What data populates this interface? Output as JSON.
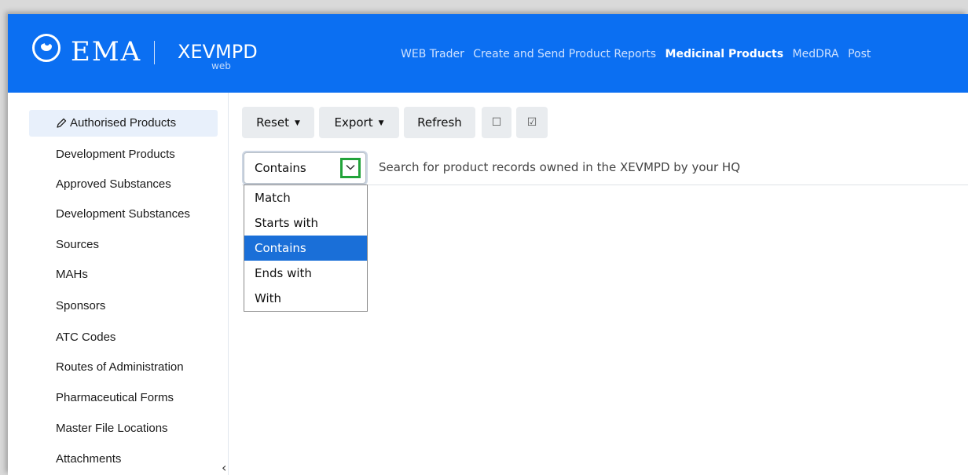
{
  "header": {
    "org_name": "EMA",
    "app_name": "XEVMPD",
    "app_sub": "web",
    "nav": [
      "WEB Trader",
      "Create and Send Product Reports",
      "Medicinal Products",
      "MedDRA",
      "Post"
    ],
    "active_nav": "Medicinal Products"
  },
  "sidebar": {
    "items": [
      "Authorised Products",
      "Development Products",
      "Approved Substances",
      "Development Substances",
      "Sources",
      "MAHs",
      "Sponsors",
      "ATC Codes",
      "Routes of Administration",
      "Pharmaceutical Forms",
      "Master File Locations",
      "Attachments"
    ],
    "collapse_glyph": "‹"
  },
  "toolbar": {
    "reset_label": "Reset",
    "export_label": "Export",
    "refresh_label": "Refresh",
    "check_empty_glyph": "☐",
    "check_checked_glyph": "☑"
  },
  "search": {
    "mode_value": "Contains",
    "placeholder": "Search for product records owned in the XEVMPD by your HQ",
    "options": [
      "Match",
      "Starts with",
      "Contains",
      "Ends with",
      "With"
    ],
    "selected_index": 2
  },
  "colors": {
    "header_bg": "#0b6ff2",
    "selected_option_bg": "#1a6fd8",
    "highlight_box": "#22a33a"
  }
}
